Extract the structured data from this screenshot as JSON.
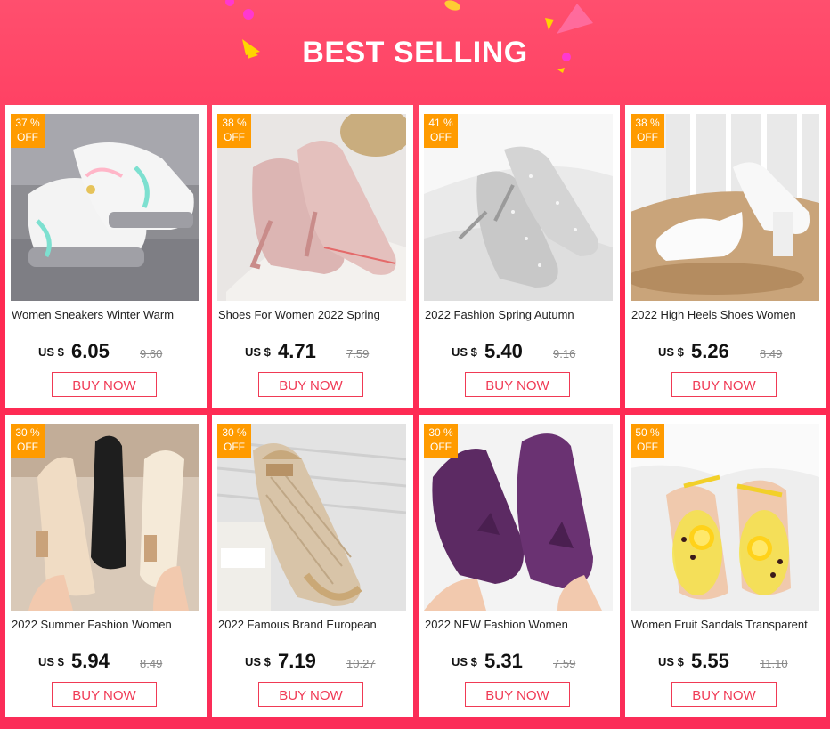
{
  "header": {
    "title": "BEST SELLING"
  },
  "colors": {
    "background": "#ff2a52",
    "badge": "#ff9b00",
    "button_border": "#f03a55",
    "price_text": "#111111"
  },
  "products": [
    {
      "discount": "37 %",
      "off": "OFF",
      "name": "Women Sneakers Winter Warm",
      "currency": "US $",
      "price": "6.05",
      "old_price": "9.60",
      "button": "BUY NOW",
      "image": "white-pink-sneakers"
    },
    {
      "discount": "38 %",
      "off": "OFF",
      "name": "Shoes For Women 2022 Spring",
      "currency": "US $",
      "price": "4.71",
      "old_price": "7.59",
      "button": "BUY NOW",
      "image": "pink-patent-heels"
    },
    {
      "discount": "41 %",
      "off": "OFF",
      "name": "2022 Fashion Spring Autumn",
      "currency": "US $",
      "price": "5.40",
      "old_price": "9.16",
      "button": "BUY NOW",
      "image": "silver-glitter-heels"
    },
    {
      "discount": "38 %",
      "off": "OFF",
      "name": "2022 High Heels Shoes Women",
      "currency": "US $",
      "price": "5.26",
      "old_price": "8.49",
      "button": "BUY NOW",
      "image": "white-platform-heels"
    },
    {
      "discount": "30 %",
      "off": "OFF",
      "name": "2022 Summer Fashion Women",
      "currency": "US $",
      "price": "5.94",
      "old_price": "8.49",
      "button": "BUY NOW",
      "image": "pointed-mules"
    },
    {
      "discount": "30 %",
      "off": "OFF",
      "name": "2022 Famous Brand European",
      "currency": "US $",
      "price": "7.19",
      "old_price": "10.27",
      "button": "BUY NOW",
      "image": "tweed-espadrille"
    },
    {
      "discount": "30 %",
      "off": "OFF",
      "name": "2022 NEW Fashion Women",
      "currency": "US $",
      "price": "5.31",
      "old_price": "7.59",
      "button": "BUY NOW",
      "image": "purple-flats"
    },
    {
      "discount": "50 %",
      "off": "OFF",
      "name": "Women Fruit Sandals Transparent",
      "currency": "US $",
      "price": "5.55",
      "old_price": "11.10",
      "button": "BUY NOW",
      "image": "lemon-sandals"
    }
  ]
}
